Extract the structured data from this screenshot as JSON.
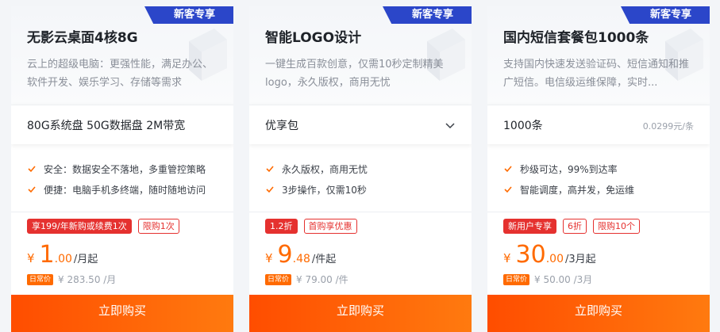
{
  "cards": [
    {
      "tag": "新客专享",
      "title": "无影云桌面4核8G",
      "desc": "云上的超级电脑：更强性能，满足办公、软件开发、娱乐学习、存储等需求",
      "spec": "80G系统盘 50G数据盘 2M带宽",
      "features": [
        "安全：数据安全不落地，多重管控策略",
        "便捷：电脑手机多终端，随时随地访问"
      ],
      "badges": [
        "享199/年新购或续费1次",
        "限购1次"
      ],
      "price_currency": "¥",
      "price_int": "1",
      "price_dec": ".00",
      "price_unit": "/月起",
      "orig_tag": "日常价",
      "orig_price": "¥ 283.50 /月",
      "buy": "立即购买"
    },
    {
      "tag": "新客专享",
      "title": "智能LOGO设计",
      "desc": "一键生成百款创意，仅需10秒定制精美logo，永久版权，商用无忧",
      "spec": "优享包",
      "spec_icon": "chevron-down-icon",
      "features": [
        "永久版权，商用无忧",
        "3步操作，仅需10秒"
      ],
      "badges": [
        "1.2折",
        "首购享优惠"
      ],
      "price_currency": "¥",
      "price_int": "9",
      "price_dec": ".48",
      "price_unit": "/件起",
      "orig_tag": "日常价",
      "orig_price": "¥ 79.00 /件",
      "buy": "立即购买"
    },
    {
      "tag": "新客专享",
      "title": "国内短信套餐包1000条",
      "desc": "支持国内快速发送验证码、短信通知和推广短信。电信级运维保障，实时...",
      "spec": "1000条",
      "spec_unit": "0.0299元/条",
      "features": [
        "秒级可达，99%到达率",
        "智能调度，高并发，免运维"
      ],
      "badges": [
        "新用户专享",
        "6折",
        "限购10个"
      ],
      "price_currency": "¥",
      "price_int": "30",
      "price_dec": ".00",
      "price_unit": "/3月起",
      "orig_tag": "日常价",
      "orig_price": "¥ 50.00 /3月",
      "buy": "立即购买"
    }
  ],
  "colors": {
    "accent_orange": "#ff6a00",
    "badge_red": "#e5312f",
    "tag_blue": "#2b46c9",
    "buy_gradient_start": "#ff4d00",
    "buy_gradient_end": "#ff7a0f"
  }
}
